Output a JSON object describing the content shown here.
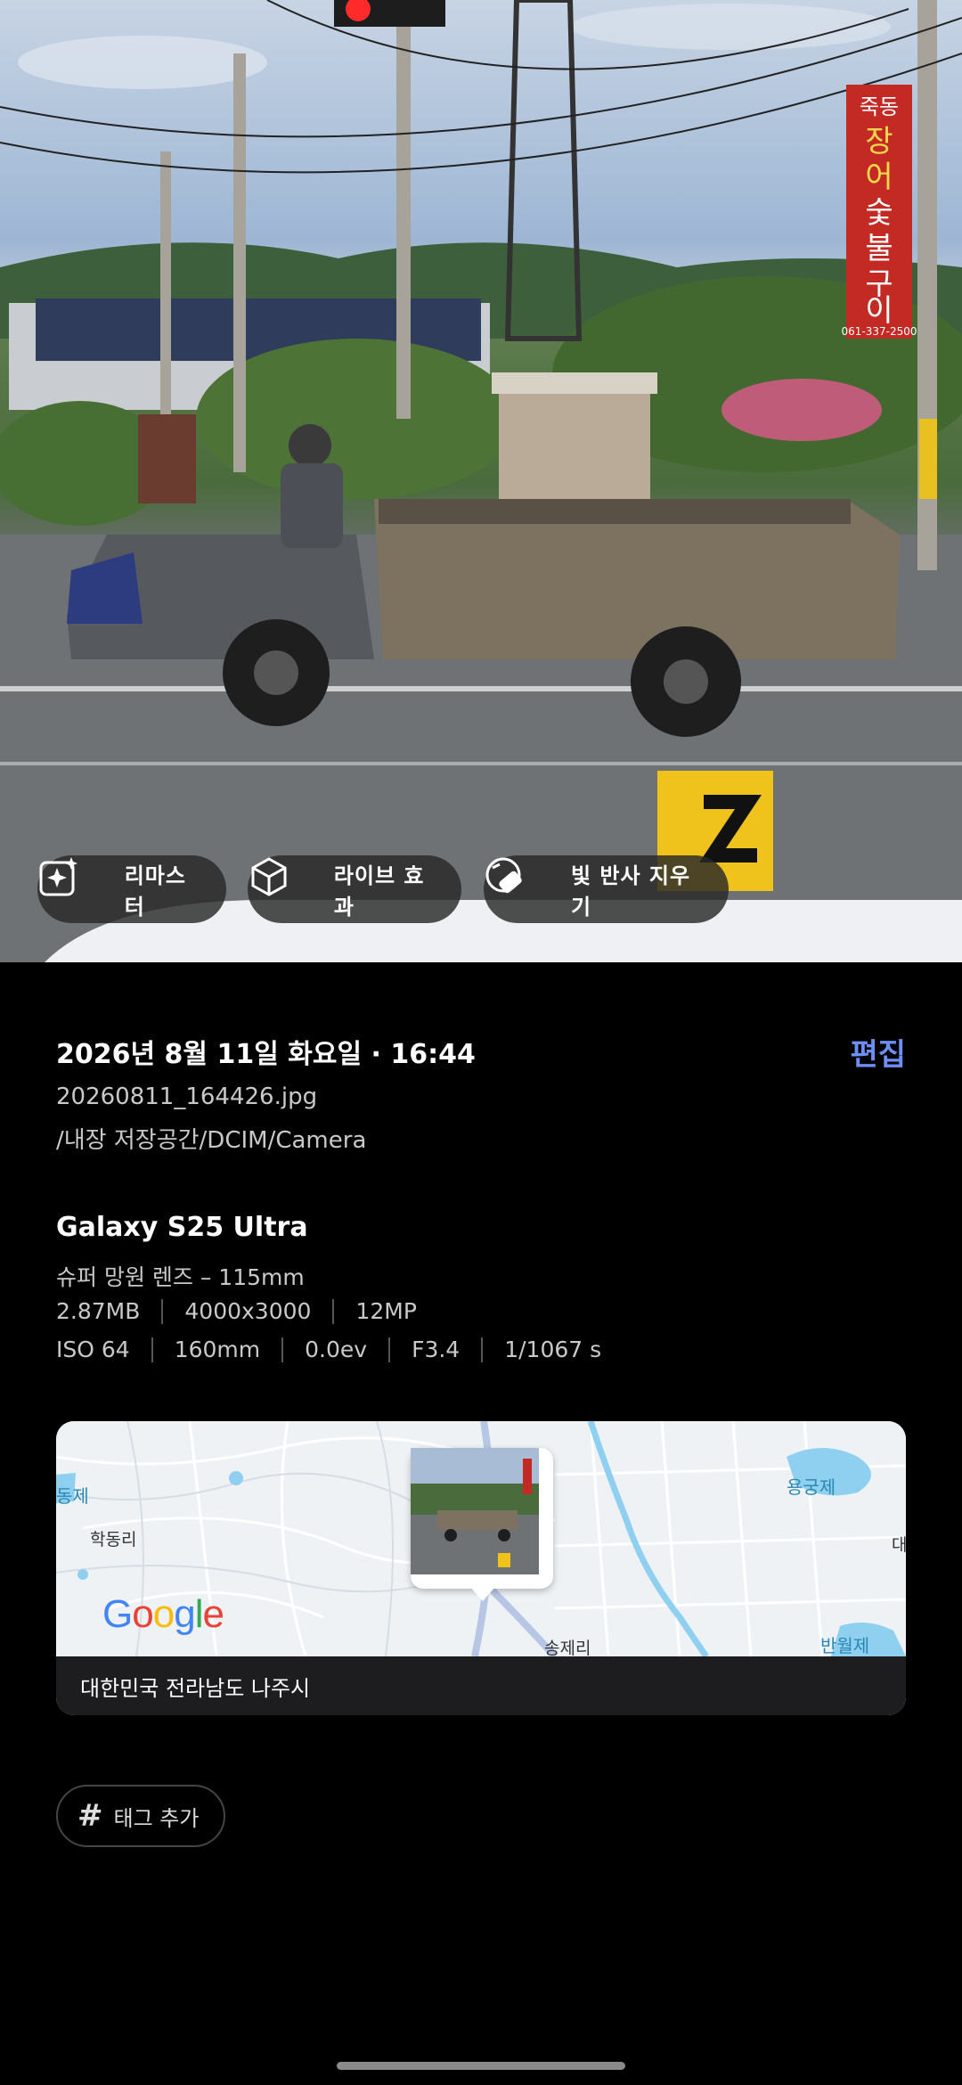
{
  "photo": {
    "scene_text": {
      "sign_vertical": [
        "죽동",
        "장어숯불구이"
      ],
      "sign_phone": "061-337-2500"
    }
  },
  "actions": [
    {
      "label": "리마스터",
      "icon": "sparkle-image-icon"
    },
    {
      "label": "라이브 효과",
      "icon": "cube-effect-icon"
    },
    {
      "label": "빛 반사 지우기",
      "icon": "eraser-reflection-icon"
    }
  ],
  "details": {
    "datetime": "2026년 8월 11일 화요일 · 16:44",
    "edit_label": "편집",
    "filename": "20260811_164426.jpg",
    "path": "/내장 저장공간/DCIM/Camera",
    "device": "Galaxy S25 Ultra",
    "lens": "슈퍼 망원 렌즈 – 115mm",
    "size": "2.87MB",
    "resolution": "4000x3000",
    "megapixels": "12MP",
    "iso": "ISO 64",
    "focal": "160mm",
    "ev": "0.0ev",
    "aperture": "F3.4",
    "shutter": "1/1067 s"
  },
  "map": {
    "labels": [
      "동제",
      "학동리",
      "용궁제",
      "대",
      "송제리",
      "반월제"
    ],
    "provider": "Google",
    "location": "대한민국 전라남도 나주시"
  },
  "tag": {
    "label": "태그 추가"
  },
  "colors": {
    "accent": "#6e8ef7",
    "background": "#000000",
    "chip": "#282828"
  }
}
